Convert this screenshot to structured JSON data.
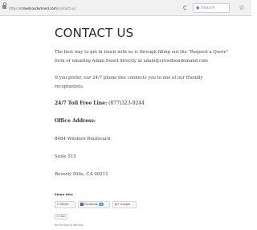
{
  "browser": {
    "url_prefix": "https://",
    "url_host": "crowdsondemand.com",
    "url_path": "/contact-us/",
    "reload_glyph": "C",
    "search_placeholder": "Search",
    "search_icon": "search-icon",
    "bookmark_glyph": "☆"
  },
  "page": {
    "title": "CONTACT US",
    "intro_line1": "The best way to get in touch with us is through filling out the \"Request a Quote\"",
    "intro_line2": "form or emailing Adam Swart directly at adam@crowdsondemand.com",
    "phone_line1": "If you prefer, our 24/7 phone line connects you to one of our friendly",
    "phone_line2": "receptionists.",
    "tollfree_label": "24/7 Toll Free Line:",
    "tollfree_number": "(877)323-9244",
    "office_heading": "Office Address:",
    "address_line1": "8484 Wilshire Boulevard",
    "address_line2": "Suite 515",
    "address_line3": "Beverly Hills, CA 90211"
  },
  "share": {
    "heading": "Share this:",
    "twitter_label": "Twitter",
    "facebook_label": "Facebook",
    "facebook_count": "12",
    "google_label": "Google",
    "like_label": "Like",
    "like_text": "Be the first to like this."
  }
}
